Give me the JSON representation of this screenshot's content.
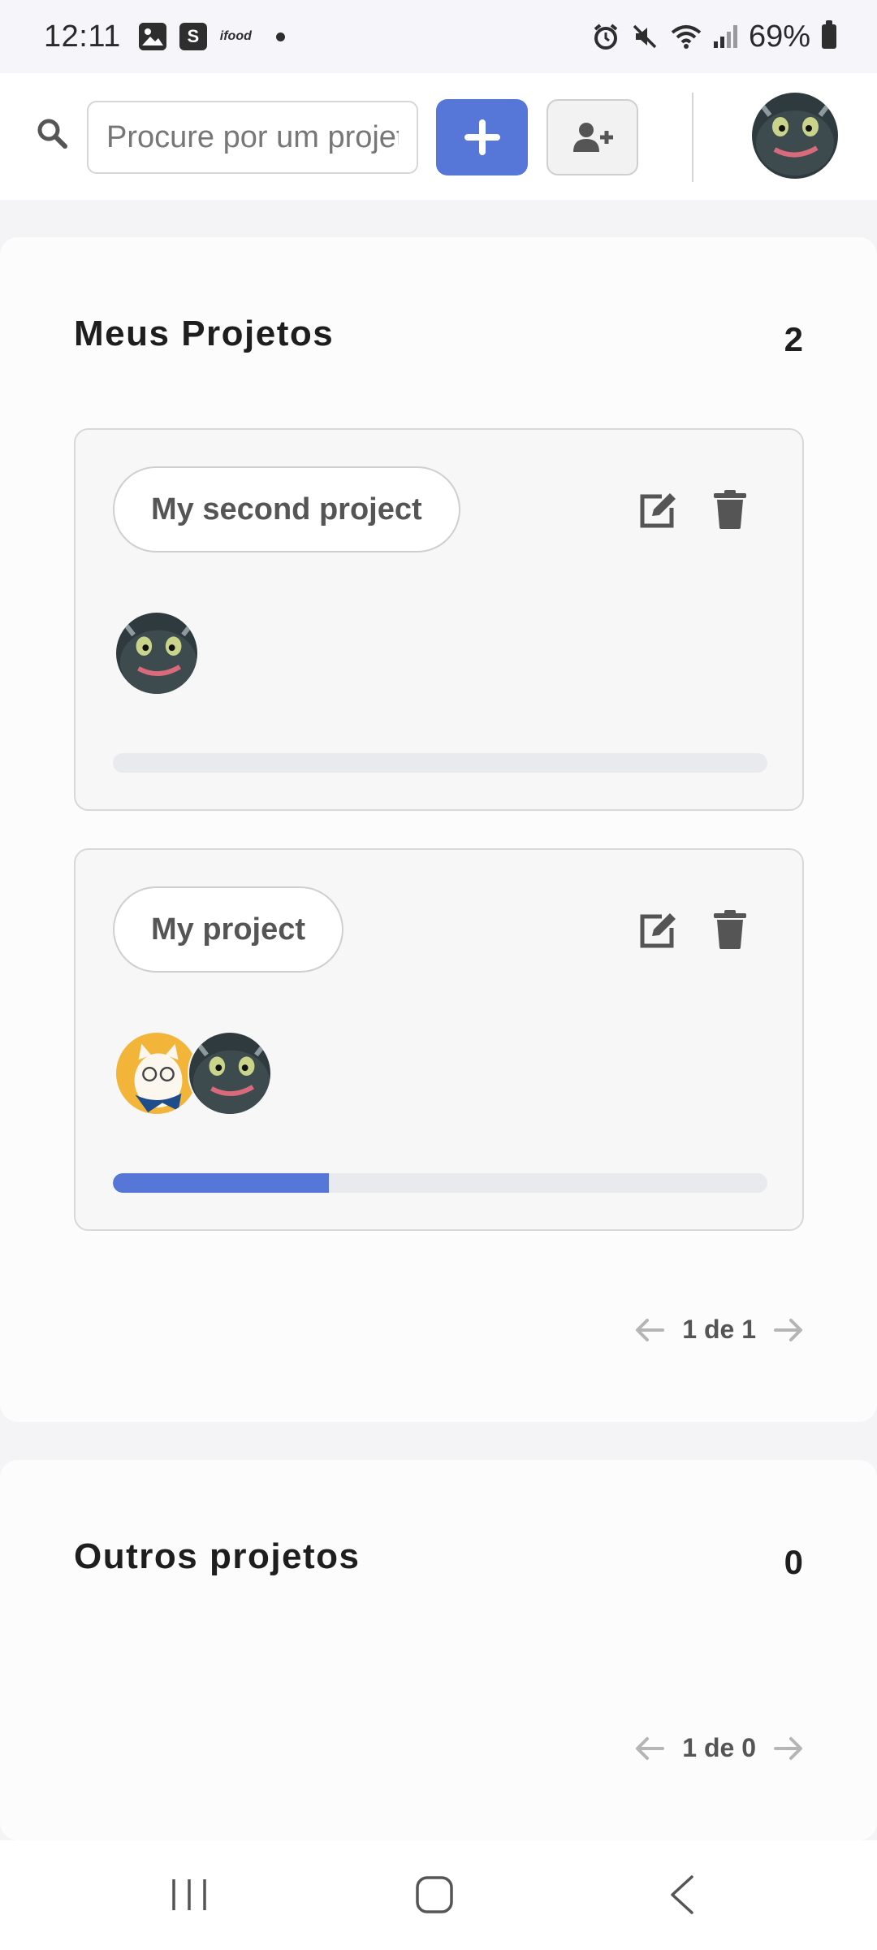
{
  "status_bar": {
    "time": "12:11",
    "ifood": "ifood",
    "battery": "69%"
  },
  "header": {
    "search_placeholder": "Procure por um projeto",
    "add_button_icon": "plus-icon",
    "add_member_icon": "user-plus-icon"
  },
  "my_projects": {
    "title": "Meus Projetos",
    "count": "2",
    "projects": [
      {
        "name": "My second project",
        "members": [
          "dragon"
        ],
        "progress": 0
      },
      {
        "name": "My project",
        "members": [
          "cat",
          "dragon"
        ],
        "progress": 0.33
      }
    ],
    "pagination": "1 de 1"
  },
  "other_projects": {
    "title": "Outros projetos",
    "count": "0",
    "pagination": "1 de 0"
  },
  "colors": {
    "accent": "#5676d8",
    "track": "#e8eaed"
  }
}
